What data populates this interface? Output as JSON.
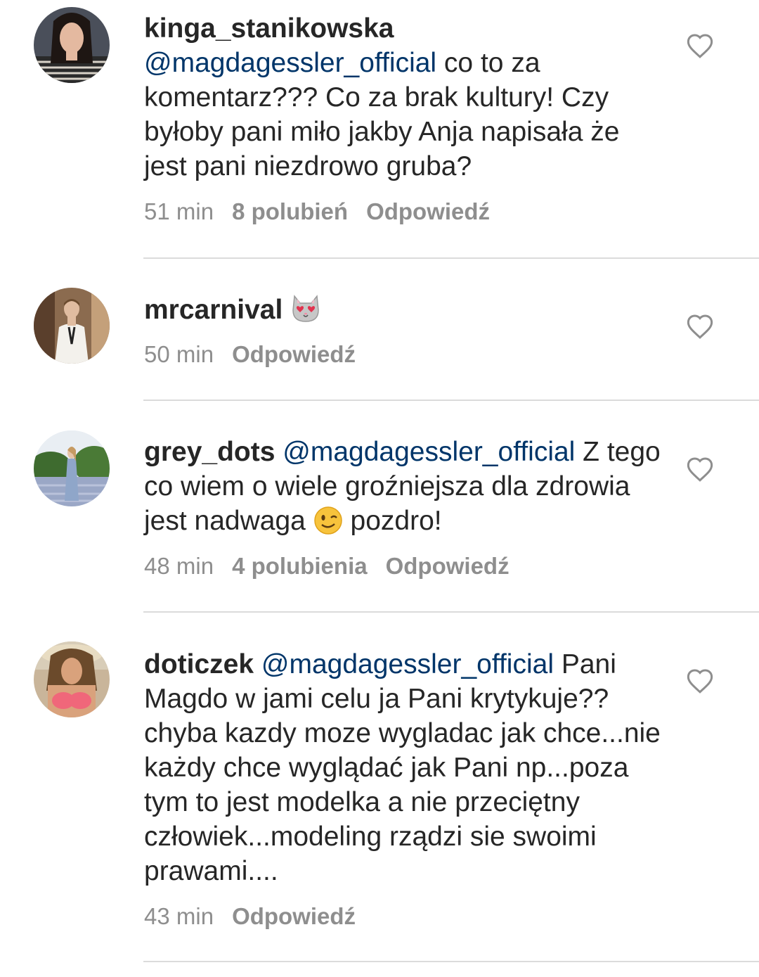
{
  "comments": [
    {
      "username": "kinga_stanikowska",
      "mention": "@magdagessler_official",
      "text": " co to za komentarz??? Co za brak kultury! Czy byłoby pani miło jakby Anja napisała że jest pani niezdrowo gruba?",
      "time": "51 min",
      "likes": "8 polubień",
      "reply": "Odpowiedź"
    },
    {
      "username": "mrcarnival",
      "emoji": "heart-eyes-cat-emoji",
      "time": "50 min",
      "reply": "Odpowiedź"
    },
    {
      "username": "grey_dots",
      "mention": "@magdagessler_official",
      "text_before": " Z tego co wiem o wiele groźniejsza dla zdrowia jest nadwaga ",
      "emoji": "winking-face-emoji",
      "text_after": " pozdro!",
      "time": "48 min",
      "likes": "4 polubienia",
      "reply": "Odpowiedź"
    },
    {
      "username": "doticzek",
      "mention": "@magdagessler_official",
      "text": " Pani Magdo w jami celu ja Pani krytykuje?? chyba kazdy moze wygladac jak chce...nie każdy chce wyglądać jak Pani np...poza tym to jest modelka a nie przeciętny człowiek...modeling rządzi sie swoimi prawami....",
      "time": "43 min",
      "reply": "Odpowiedź"
    }
  ],
  "colors": {
    "text": "#262626",
    "mention": "#003569",
    "meta": "#8e8e8e",
    "divider": "#dbdbdb"
  },
  "icons": [
    "heart-outline-icon"
  ]
}
